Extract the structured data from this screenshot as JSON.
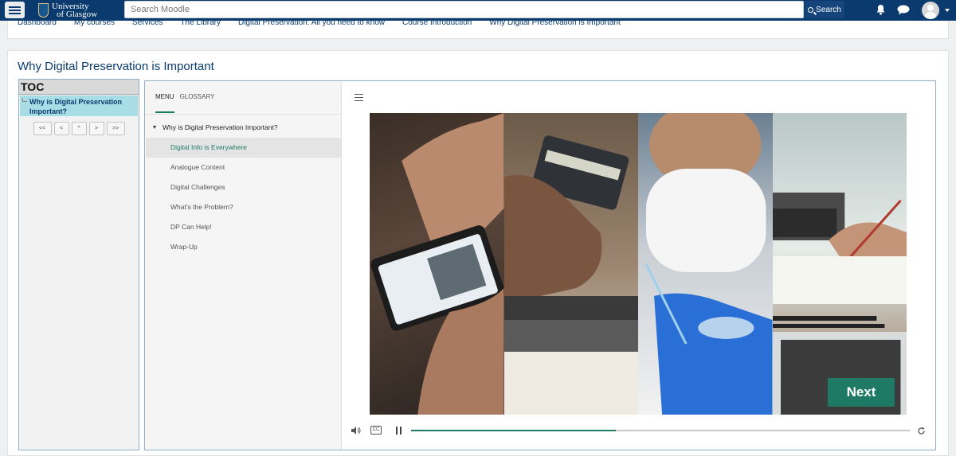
{
  "navbar": {
    "logo_line1": "University",
    "logo_line2": "of Glasgow",
    "search_placeholder": "Search Moodle",
    "search_label": "Search"
  },
  "breadcrumb": [
    "Dashboard",
    "My courses",
    "Services",
    "The Library",
    "Digital Preservation: All you need to know",
    "Course Introduction",
    "Why Digital Preservation is Important"
  ],
  "page": {
    "title": "Why Digital Preservation is Important"
  },
  "toc": {
    "header": "TOC",
    "item": "Why is Digital Preservation Important?",
    "controls": [
      "<<",
      "<",
      "^",
      ">",
      ">>"
    ]
  },
  "player": {
    "tabs": {
      "menu": "MENU",
      "glossary": "GLOSSARY"
    },
    "outline_heading": "Why is Digital Preservation Important?",
    "outline": [
      {
        "label": "Digital Info is Everywhere",
        "active": true
      },
      {
        "label": "Analogue Content",
        "active": false
      },
      {
        "label": "Digital Challenges",
        "active": false
      },
      {
        "label": "What's the Problem?",
        "active": false
      },
      {
        "label": "DP Can Help!",
        "active": false
      },
      {
        "label": "Wrap-Up",
        "active": false
      }
    ],
    "next_label": "Next",
    "cc_label": "CC",
    "progress": 0.41
  },
  "colors": {
    "navbar": "#0b3b6e",
    "accent": "#1e7a64",
    "toc_highlight": "#a8dde5"
  }
}
